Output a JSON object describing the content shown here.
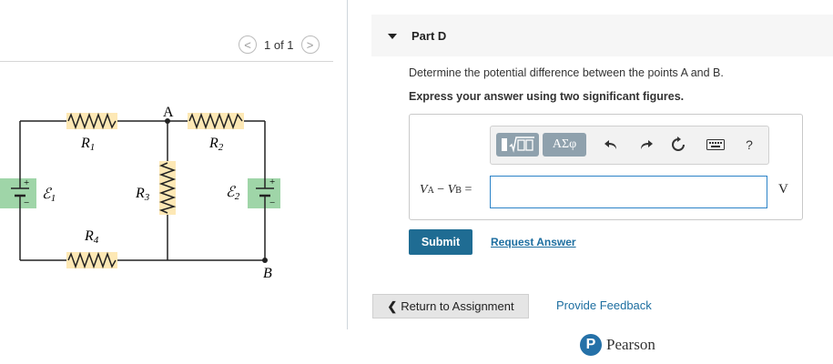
{
  "pager": {
    "prev": "<",
    "text": "1 of 1",
    "next": ">"
  },
  "circuit": {
    "r1": "R",
    "r1_sub": "1",
    "r2": "R",
    "r2_sub": "2",
    "r3": "R",
    "r3_sub": "3",
    "r4": "R",
    "r4_sub": "4",
    "e1": "ℰ",
    "e1_sub": "1",
    "e2": "ℰ",
    "e2_sub": "2",
    "node_a": "A",
    "node_b": "B",
    "plus": "+",
    "minus": "−"
  },
  "part": {
    "title": "Part D",
    "question": "Determine the potential difference between the points A and B.",
    "instruction": "Express your answer using two significant figures."
  },
  "toolbar": {
    "templates_icon": "templates-icon",
    "symbols_label": "ΑΣφ",
    "help": "?"
  },
  "answer": {
    "label_v1": "V",
    "label_v1_sub": "A",
    "label_minus": " − ",
    "label_v2": "V",
    "label_v2_sub": "B",
    "label_eq": " =",
    "value": "",
    "unit": "V"
  },
  "buttons": {
    "submit": "Submit",
    "request_answer": "Request Answer",
    "return": "Return to Assignment",
    "feedback": "Provide Feedback"
  },
  "brand": {
    "logo_letter": "P",
    "name": "Pearson"
  },
  "colors": {
    "resistor_fill": "#fde8b5",
    "battery_fill": "#9fd5a8",
    "submit": "#1f6c93",
    "link": "#1d6ea0"
  }
}
